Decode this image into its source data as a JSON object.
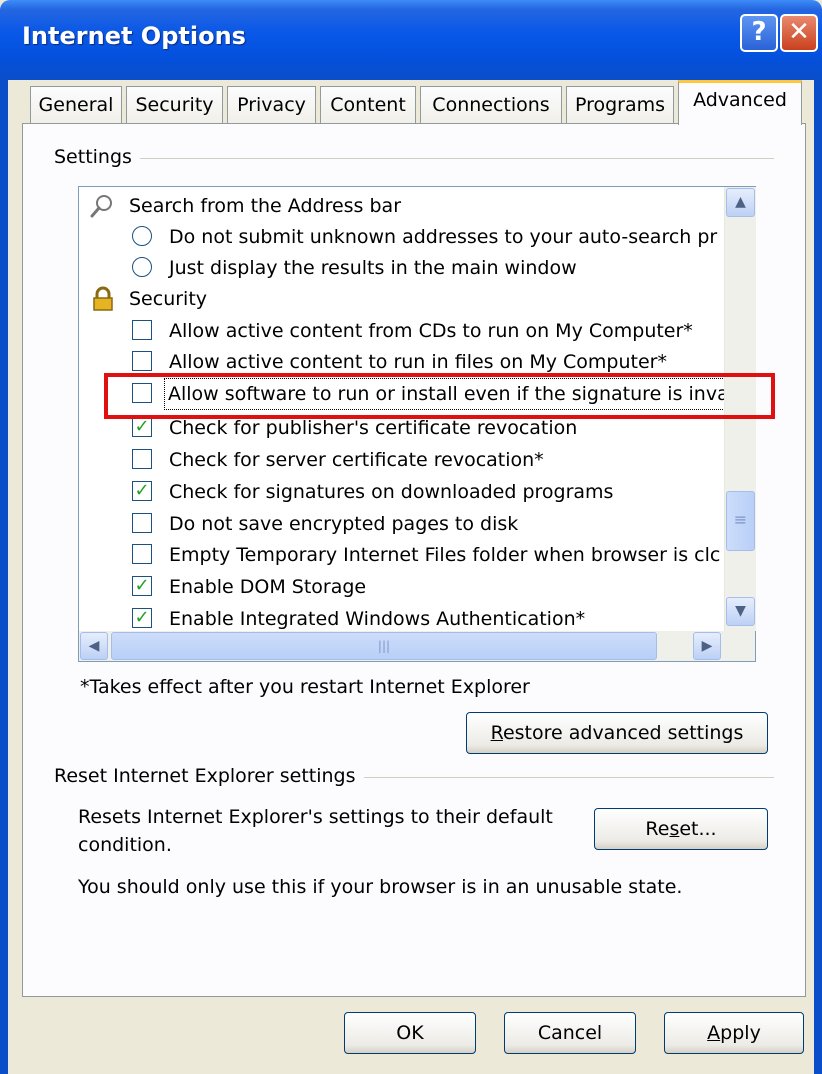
{
  "window": {
    "title": "Internet Options"
  },
  "titlebar": {
    "help_label": "?",
    "close_label": "✕"
  },
  "tabs": [
    {
      "label": "General"
    },
    {
      "label": "Security"
    },
    {
      "label": "Privacy"
    },
    {
      "label": "Content"
    },
    {
      "label": "Connections"
    },
    {
      "label": "Programs"
    },
    {
      "label": "Advanced",
      "active": true
    }
  ],
  "settings": {
    "group_label": "Settings",
    "items": [
      {
        "type": "group",
        "icon": "magnifier-icon",
        "label": "Search from the Address bar"
      },
      {
        "type": "radio",
        "checked": false,
        "label": "Do not submit unknown addresses to your auto-search pr"
      },
      {
        "type": "radio",
        "checked": false,
        "label": "Just display the results in the main window"
      },
      {
        "type": "group",
        "icon": "lock-icon",
        "label": "Security"
      },
      {
        "type": "checkbox",
        "checked": false,
        "label": "Allow active content from CDs to run on My Computer*"
      },
      {
        "type": "checkbox",
        "checked": false,
        "label": "Allow active content to run in files on My Computer*"
      },
      {
        "type": "checkbox",
        "checked": false,
        "label": "Allow software to run or install even if the signature is invalid",
        "highlighted": true
      },
      {
        "type": "checkbox",
        "checked": true,
        "label": "Check for publisher's certificate revocation"
      },
      {
        "type": "checkbox",
        "checked": false,
        "label": "Check for server certificate revocation*"
      },
      {
        "type": "checkbox",
        "checked": true,
        "label": "Check for signatures on downloaded programs"
      },
      {
        "type": "checkbox",
        "checked": false,
        "label": "Do not save encrypted pages to disk"
      },
      {
        "type": "checkbox",
        "checked": false,
        "label": "Empty Temporary Internet Files folder when browser is clc"
      },
      {
        "type": "checkbox",
        "checked": true,
        "label": "Enable DOM Storage"
      },
      {
        "type": "checkbox",
        "checked": true,
        "label": "Enable Integrated Windows Authentication*"
      }
    ],
    "footnote": "*Takes effect after you restart Internet Explorer",
    "restore_button": {
      "prefix": "",
      "accel": "R",
      "rest": "estore advanced settings"
    }
  },
  "reset": {
    "group_label": "Reset Internet Explorer settings",
    "description_line1": "Resets Internet Explorer's settings to their default",
    "description_line2": "condition.",
    "button": {
      "prefix": "Re",
      "accel": "s",
      "rest": "et..."
    },
    "warning": "You should only use this if your browser is in an unusable state."
  },
  "footer": {
    "ok_label": "OK",
    "cancel_label": "Cancel",
    "apply": {
      "prefix": "",
      "accel": "A",
      "rest": "pply"
    }
  },
  "colors": {
    "titlebar": "#0a4ec9",
    "active_tab_accent": "#ffc83c",
    "highlight_box": "#e01010",
    "check_green": "#21a121"
  },
  "scrollbars": {
    "up": "▲",
    "down": "▼",
    "left": "◀",
    "right": "▶",
    "grip": "≡",
    "hgrip": "|||"
  }
}
